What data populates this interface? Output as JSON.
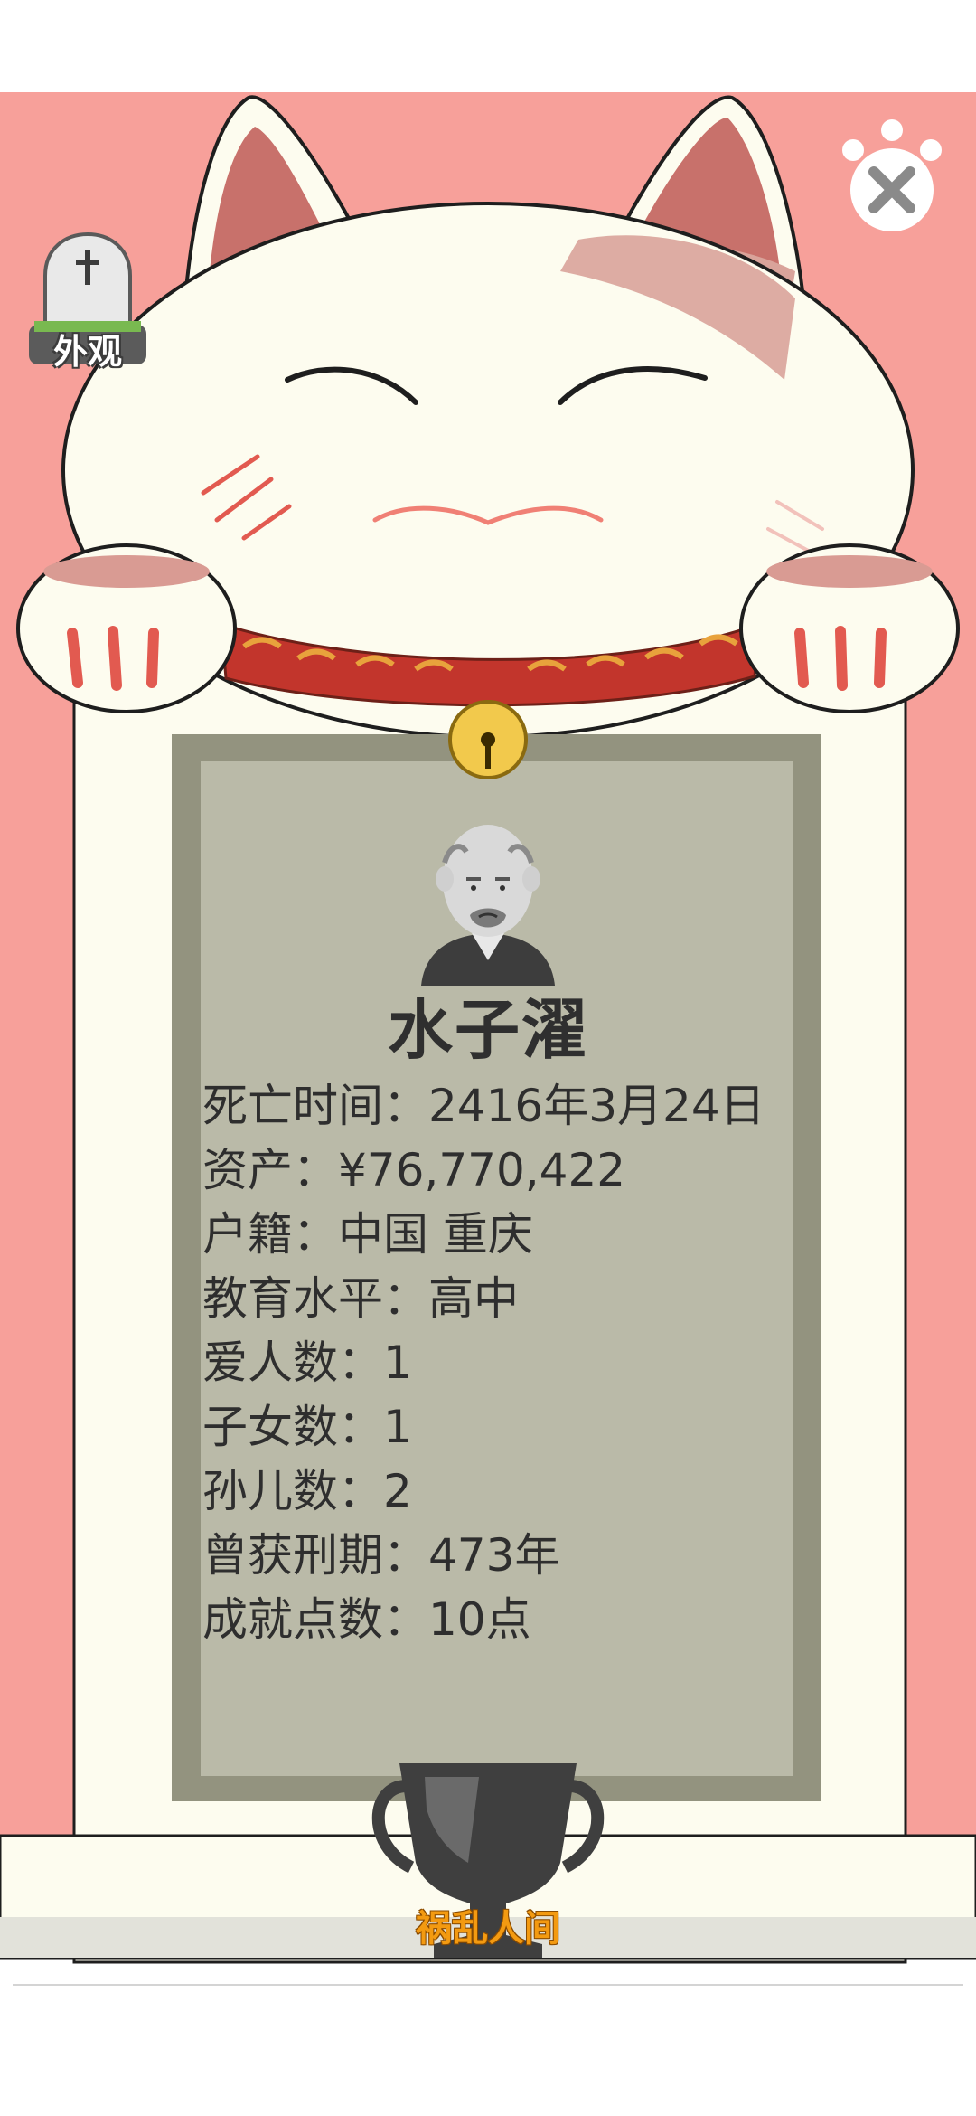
{
  "colors": {
    "background_pink": "#f7a09a",
    "frame_cream": "#fdfcef",
    "plaque_gray": "#babaa8",
    "plaque_border": "#93937f",
    "title_orange": "#f39a11"
  },
  "appearance_button": {
    "label": "外观",
    "icon": "tombstone-cross-icon"
  },
  "close_button": {
    "icon": "paw-close-icon"
  },
  "epitaph": {
    "avatar": "old-man-avatar",
    "name": "水子濯",
    "fields": [
      {
        "label": "死亡时间：",
        "value": "2416年3月24日"
      },
      {
        "label": "资产：",
        "value": "¥76,770,422"
      },
      {
        "label": "户籍：",
        "value": "中国 重庆"
      },
      {
        "label": "教育水平：",
        "value": "高中"
      },
      {
        "label": "爱人数：",
        "value": "1"
      },
      {
        "label": "子女数：",
        "value": "1"
      },
      {
        "label": "孙儿数：",
        "value": "2"
      },
      {
        "label": "曾获刑期：",
        "value": "473年"
      },
      {
        "label": "成就点数：",
        "value": "10点"
      }
    ]
  },
  "trophy": {
    "icon": "trophy-icon",
    "title": "祸乱人间"
  }
}
